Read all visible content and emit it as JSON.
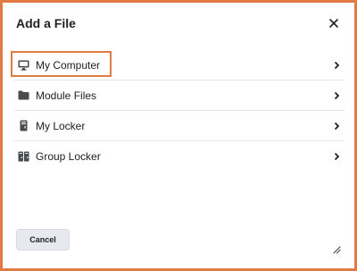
{
  "dialog": {
    "title": "Add a File",
    "close_icon": "close-icon",
    "items": [
      {
        "label": "My Computer",
        "icon": "computer-icon"
      },
      {
        "label": "Module Files",
        "icon": "folder-icon"
      },
      {
        "label": "My Locker",
        "icon": "locker-icon"
      },
      {
        "label": "Group Locker",
        "icon": "group-locker-icon"
      }
    ],
    "cancel_label": "Cancel"
  },
  "colors": {
    "frame_accent": "#e07b45",
    "text": "#202122",
    "divider": "#e3e5e8",
    "button_bg": "#e6e9ee"
  }
}
